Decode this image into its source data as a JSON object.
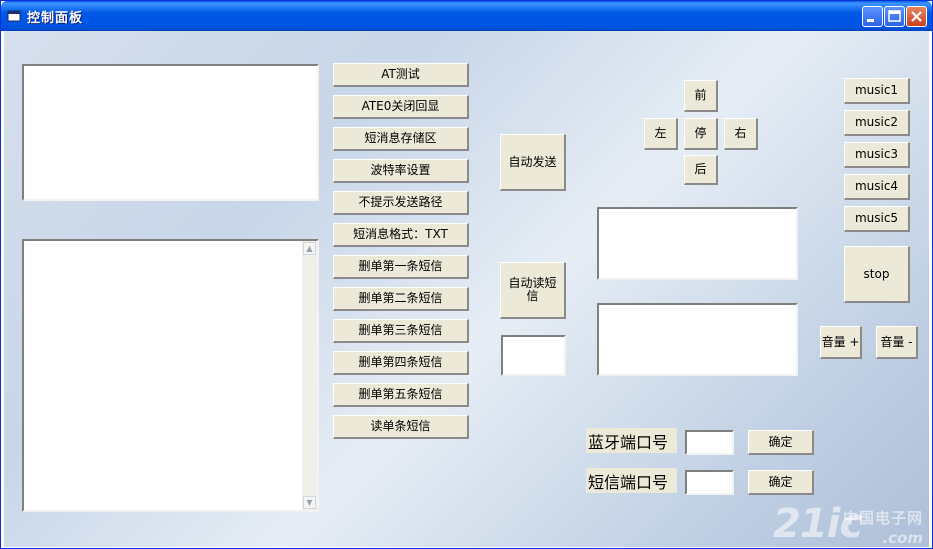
{
  "window": {
    "title": "控制面板",
    "icon": "app-window-icon",
    "controls": [
      "minimize-icon",
      "maximize-icon",
      "close-icon"
    ]
  },
  "at_buttons": [
    "AT测试",
    "ATE0关闭回显",
    "短消息存储区",
    "波特率设置",
    "不提示发送路径",
    "短消息格式：TXT",
    "删单第一条短信",
    "删单第二条短信",
    "删单第三条短信",
    "删单第四条短信",
    "删单第五条短信",
    "读单条短信"
  ],
  "auto_send": "自动发送",
  "auto_read": "自动读短信",
  "direction": {
    "forward": "前",
    "left": "左",
    "stop": "停",
    "right": "右",
    "back": "后"
  },
  "music": {
    "tracks": [
      "music1",
      "music2",
      "music3",
      "music4",
      "music5"
    ],
    "stop": "stop"
  },
  "volume": {
    "up": "音量 +",
    "down": "音量 -"
  },
  "ports": {
    "bluetooth_label": "蓝牙端口号",
    "bluetooth_value": "",
    "bluetooth_confirm": "确定",
    "sms_label": "短信端口号",
    "sms_value": "",
    "sms_confirm": "确定"
  },
  "watermark": {
    "number": "21ic",
    "name": "中国电子网",
    "domain": ".com"
  }
}
